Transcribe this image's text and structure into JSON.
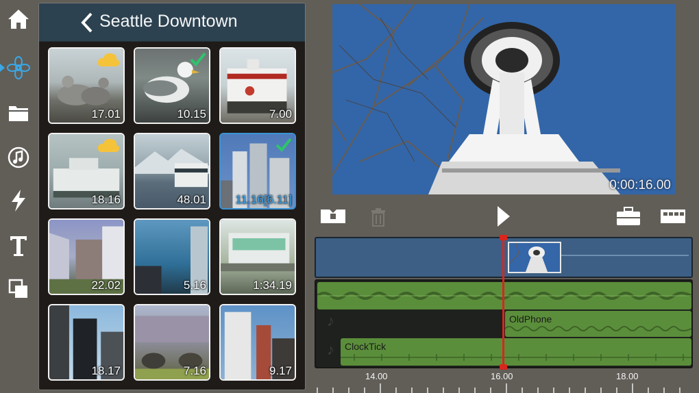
{
  "toolbar": {
    "tools": [
      {
        "icon": "home-icon"
      },
      {
        "icon": "media-flower-icon",
        "selected": true
      },
      {
        "icon": "folder-icon"
      },
      {
        "icon": "music-note-icon"
      },
      {
        "icon": "lightning-icon"
      },
      {
        "icon": "text-icon"
      },
      {
        "icon": "overlay-icon"
      }
    ]
  },
  "browser": {
    "title": "Seattle Downtown",
    "thumbnails": [
      {
        "duration": "17.01",
        "badge": "cloud"
      },
      {
        "duration": "10.15",
        "badge": "check"
      },
      {
        "duration": "7.00"
      },
      {
        "duration": "18.16",
        "badge": "cloud"
      },
      {
        "duration": "48.01"
      },
      {
        "duration": "11.16[6.11]",
        "badge": "check",
        "selected": true
      },
      {
        "duration": "22.02"
      },
      {
        "duration": "5.16"
      },
      {
        "duration": "1:34.19"
      },
      {
        "duration": "18.17"
      },
      {
        "duration": "7.16"
      },
      {
        "duration": "9.17"
      }
    ]
  },
  "preview": {
    "timecode": "0:00:16.00"
  },
  "timeline": {
    "audio_clips": {
      "phone": "OldPhone",
      "tick": "ClockTick"
    },
    "ruler": {
      "labels": [
        "14.00",
        "16.00",
        "18.00"
      ]
    }
  },
  "colors": {
    "accent": "#3aa7e6",
    "playhead": "#d9261c",
    "audio_clip": "#5b8e3b",
    "video_track": "#3d5f85"
  }
}
